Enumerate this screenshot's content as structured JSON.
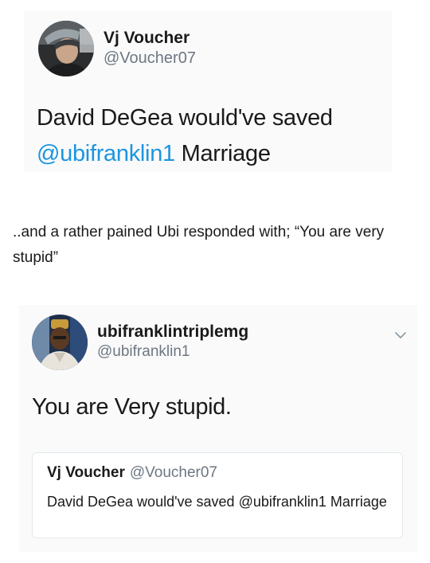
{
  "first_tweet": {
    "author_name": "Vj Voucher",
    "author_handle": "@Voucher07",
    "text_before_mention": "David DeGea would've saved",
    "mention": "@ubifranklin1",
    "text_after_mention": " Marriage"
  },
  "caption": "..and a rather pained Ubi responded with; “You are very stupid”",
  "second_tweet": {
    "author_name": "ubifranklintriplemg",
    "author_handle": "@ubifranklin1",
    "menu_icon": "chevron-down-icon",
    "text": "You are Very stupid.",
    "quoted_tweet": {
      "author_name": "Vj Voucher",
      "author_handle": "@Voucher07",
      "text": "David DeGea would've saved @ubifranklin1 Marriage"
    }
  },
  "colors": {
    "mention": "#1b95e0",
    "handle": "#6d7782",
    "card_background": "#fafafa",
    "quote_border": "#e1e8ed"
  }
}
